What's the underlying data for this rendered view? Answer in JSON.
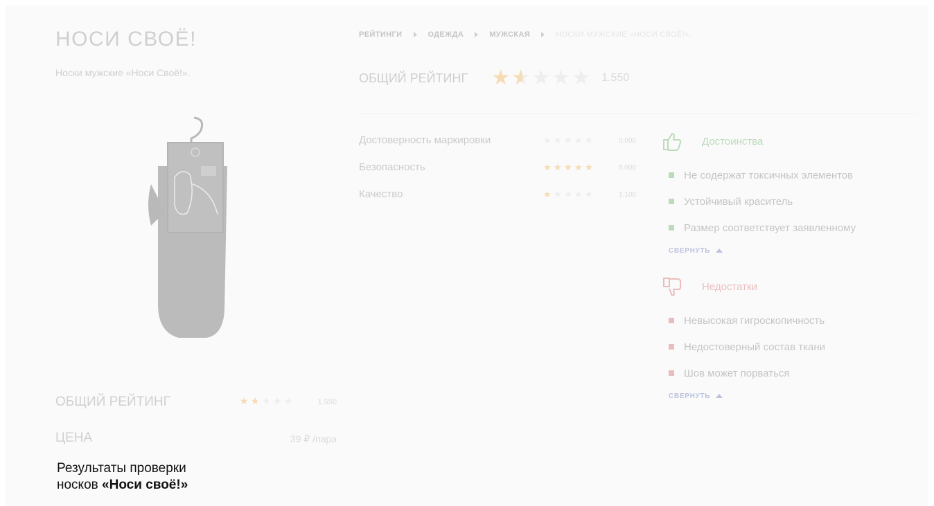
{
  "product": {
    "brand": "НОСИ СВОЁ!",
    "subtitle": "Носки мужские «Носи Своё!».",
    "image_label": "socks-product-image"
  },
  "breadcrumb": [
    "РЕЙТИНГИ",
    "ОДЕЖДА",
    "МУЖСКАЯ",
    "НОСКИ МУЖСКИЕ «НОСИ СВОЁ!»."
  ],
  "overall": {
    "label": "ОБЩИЙ РЕЙТИНГ",
    "value": "1.550",
    "stars": 1.55
  },
  "criteria": [
    {
      "name": "Достоверность маркировки",
      "score": "0.000",
      "stars": 0
    },
    {
      "name": "Безопасность",
      "score": "5.000",
      "stars": 5
    },
    {
      "name": "Качество",
      "score": "1.100",
      "stars": 1.1
    }
  ],
  "pros": {
    "title": "Достоинства",
    "items": [
      "Не содержат токсичных элементов",
      "Устойчивый краситель",
      "Размер соответствует заявленному"
    ],
    "collapse_label": "СВЕРНУТЬ"
  },
  "cons": {
    "title": "Недостатки",
    "items": [
      "Невысокая гигроскопичность",
      "Недостоверный состав ткани",
      "Шов может порваться"
    ],
    "collapse_label": "СВЕРНУТЬ"
  },
  "summary": {
    "rating_label": "ОБЩИЙ РЕЙТИНГ",
    "rating_value": "1.550",
    "rating_stars": 1.55,
    "price_label": "ЦЕНА",
    "price_value": "39 ₽ /пара"
  },
  "caption": {
    "line1": "Результаты проверки",
    "line2_prefix": "носков ",
    "line2_bold": "«Носи своё!»"
  },
  "colors": {
    "star": "#f0a020",
    "pros": "#3c9a3c",
    "cons": "#c94040",
    "link": "#3b4ea8"
  }
}
